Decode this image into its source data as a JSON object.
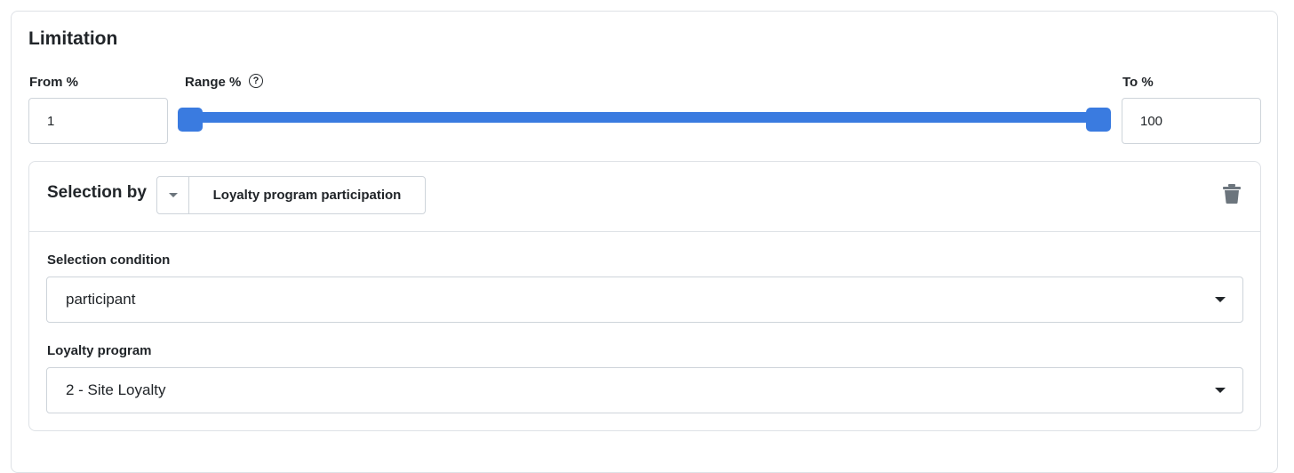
{
  "section": {
    "title": "Limitation"
  },
  "range": {
    "from_label": "From %",
    "from_value": "1",
    "range_label": "Range %",
    "help_icon": "question-circle-icon",
    "to_label": "To %",
    "to_value": "100",
    "min_fraction": 0.0,
    "max_fraction": 1.0,
    "accent": "#3a7be0"
  },
  "selection": {
    "by_label": "Selection by",
    "type_value": "Loyalty program participation",
    "delete_icon": "trash-icon",
    "condition_label": "Selection condition",
    "condition_value": "participant",
    "program_label": "Loyalty program",
    "program_value": "2 - Site Loyalty"
  }
}
